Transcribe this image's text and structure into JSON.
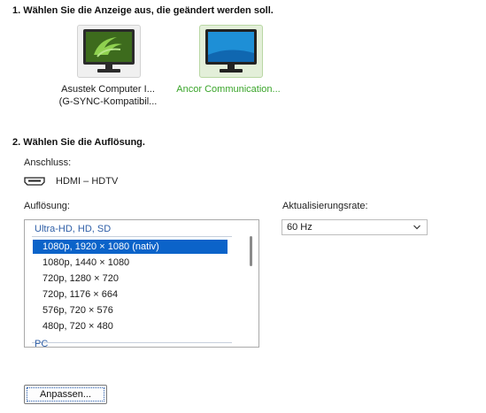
{
  "section1": {
    "heading": "1. Wählen Sie die Anzeige aus, die geändert werden soll."
  },
  "displays": [
    {
      "line1": "Asustek Computer I...",
      "line2": "(G-SYNC-Kompatibil...",
      "icon": "nvidia-monitor-icon"
    },
    {
      "line1": "Ancor Communication...",
      "line2": "",
      "icon": "monitor-icon"
    }
  ],
  "section2": {
    "heading": "2. Wählen Sie die Auflösung.",
    "connection_label": "Anschluss:",
    "connection_value": "HDMI – HDTV",
    "resolution_label": "Auflösung:",
    "refresh_label": "Aktualisierungsrate:",
    "refresh_value": "60 Hz"
  },
  "resolution_list": {
    "group1": "Ultra-HD, HD, SD",
    "items": [
      "1080p, 1920 × 1080 (nativ)",
      "1080p, 1440 × 1080",
      "720p, 1280 × 720",
      "720p, 1176 × 664",
      "576p, 720 × 576",
      "480p, 720 × 480"
    ],
    "selected_index": 0,
    "group2": "PC"
  },
  "customize_button": "Anpassen...",
  "colors": {
    "selection": "#0b63c9",
    "accent_green": "#3aa52a",
    "group_header": "#2f5fa7"
  }
}
